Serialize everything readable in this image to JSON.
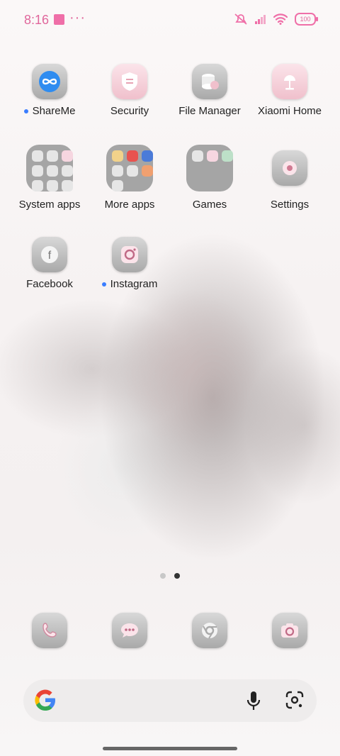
{
  "status": {
    "time": "8:16",
    "battery": "100"
  },
  "apps": [
    {
      "label": "ShareMe",
      "icon": "shareme-icon",
      "new": true
    },
    {
      "label": "Security",
      "icon": "security-icon",
      "new": false
    },
    {
      "label": "File Manager",
      "icon": "file-manager-icon",
      "new": false
    },
    {
      "label": "Xiaomi Home",
      "icon": "xiaomi-home-icon",
      "new": false
    },
    {
      "label": "System apps",
      "icon": "folder-icon",
      "new": false
    },
    {
      "label": "More apps",
      "icon": "folder-icon",
      "new": false
    },
    {
      "label": "Games",
      "icon": "folder-icon",
      "new": false
    },
    {
      "label": "Settings",
      "icon": "settings-icon",
      "new": false
    },
    {
      "label": "Facebook",
      "icon": "facebook-icon",
      "new": false
    },
    {
      "label": "Instagram",
      "icon": "instagram-icon",
      "new": true
    }
  ],
  "dock": [
    {
      "icon": "phone-icon"
    },
    {
      "icon": "messages-icon"
    },
    {
      "icon": "chrome-icon"
    },
    {
      "icon": "camera-icon"
    }
  ],
  "pager": {
    "pages": 2,
    "current": 2
  },
  "search": {
    "placeholder": ""
  },
  "colors": {
    "accent": "#ef6fa8",
    "new_dot": "#3a7dff"
  }
}
